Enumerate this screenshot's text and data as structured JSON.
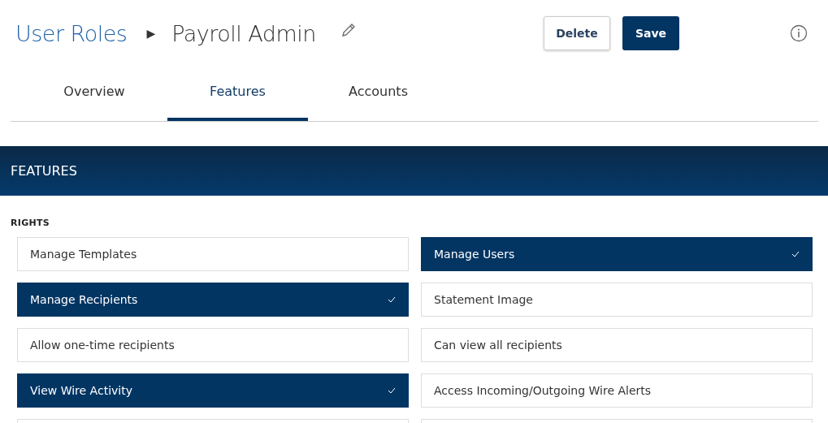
{
  "breadcrumb": {
    "parent": "User Roles",
    "separator": "▶",
    "current": "Payroll Admin"
  },
  "buttons": [
    {
      "label": "Delete",
      "kind": "secondary"
    },
    {
      "label": "Save",
      "kind": "primary"
    }
  ],
  "tabs": [
    {
      "label": "Overview",
      "selected": false
    },
    {
      "label": "Features",
      "selected": true
    },
    {
      "label": "Accounts",
      "selected": false
    }
  ],
  "banner": {
    "title": "FEATURES"
  },
  "section": {
    "title": "RIGHTS"
  },
  "rights": [
    {
      "label": "Manage Templates",
      "selected": false
    },
    {
      "label": "Manage Users",
      "selected": true
    },
    {
      "label": "Manage Recipients",
      "selected": true
    },
    {
      "label": "Statement Image",
      "selected": false
    },
    {
      "label": "Allow one-time recipients",
      "selected": false
    },
    {
      "label": "Can view all recipients",
      "selected": false
    },
    {
      "label": "View Wire Activity",
      "selected": true
    },
    {
      "label": "Access Incoming/Outgoing Wire Alerts",
      "selected": false
    }
  ]
}
